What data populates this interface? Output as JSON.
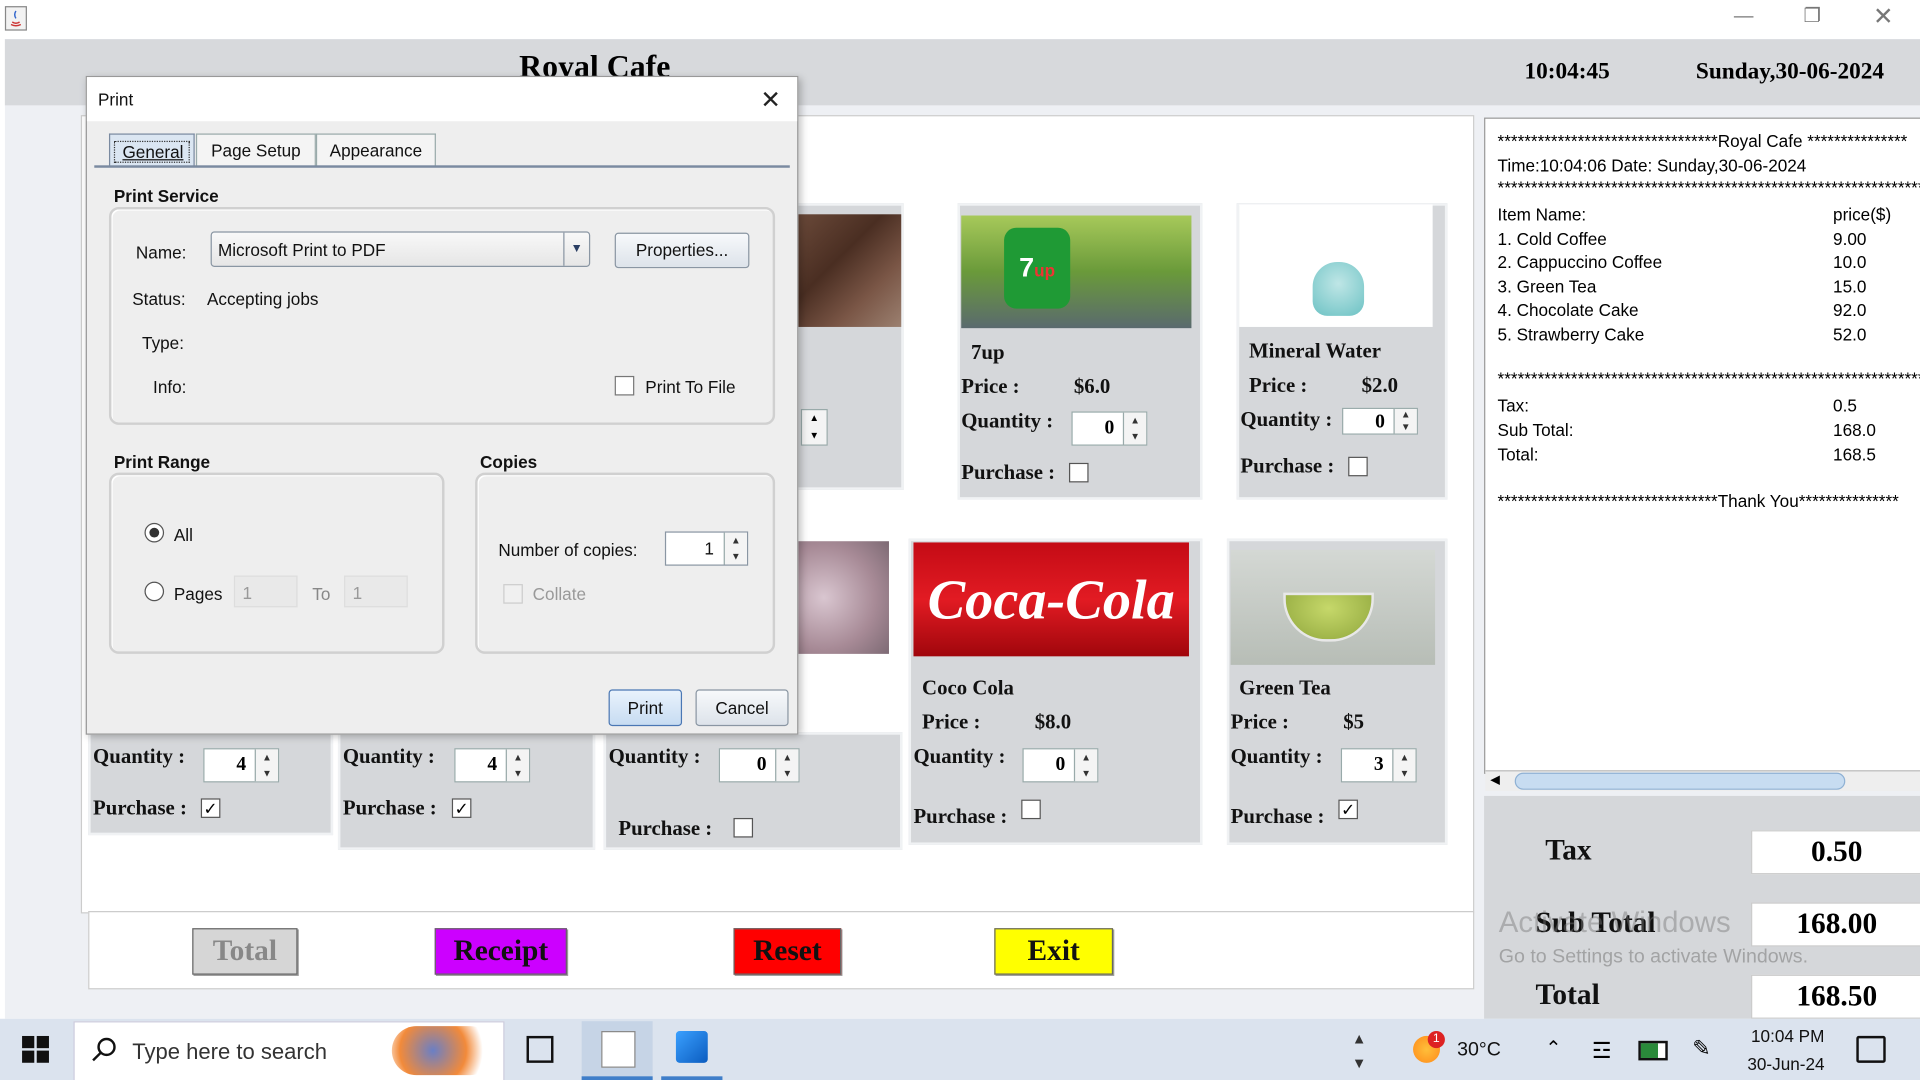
{
  "app": {
    "title": "Royal Cafe",
    "time": "10:04:45",
    "date": "Sunday,30-06-2024"
  },
  "items": [
    {
      "name": "7up",
      "price_label": "Price :",
      "price": "$6.0",
      "qty_label": "Quantity :",
      "qty": "0",
      "purchase_label": "Purchase :",
      "purchased": false
    },
    {
      "name": "Mineral Water",
      "price_label": "Price :",
      "price": "$2.0",
      "qty_label": "Quantity :",
      "qty": "0",
      "purchase_label": "Purchase :",
      "purchased": false
    },
    {
      "name": "Coco Cola",
      "price_label": "Price :",
      "price": "$8.0",
      "qty_label": "Quantity :",
      "qty": "0",
      "purchase_label": "Purchase :",
      "purchased": false
    },
    {
      "name": "Green Tea",
      "price_label": "Price :",
      "price": "$5",
      "qty_label": "Quantity :",
      "qty": "3",
      "purchase_label": "Purchase :",
      "purchased": true
    }
  ],
  "partial_cards": [
    {
      "qty_label": "Quantity :",
      "qty": "4",
      "purchase_label": "Purchase :",
      "purchased": true
    },
    {
      "qty_label": "Quantity :",
      "qty": "4",
      "purchase_label": "Purchase :",
      "purchased": true
    },
    {
      "qty_label": "Quantity :",
      "qty": "0",
      "purchase_label": "Purchase :",
      "purchased": false
    }
  ],
  "buttons": {
    "total": "Total",
    "receipt": "Receipt",
    "reset": "Reset",
    "exit": "Exit",
    "colors": {
      "total": "#d3d3d3",
      "receipt": "#cc00ff",
      "reset": "#ff0000",
      "exit": "#ffff00"
    }
  },
  "receipt": {
    "header": "*********************************Royal Cafe ***************",
    "timeline": "Time:10:04:06 Date: Sunday,30-06-2024",
    "stars": "********************************************************************",
    "col_item": "Item Name:",
    "col_price": "price($)",
    "lines": [
      {
        "item": "1. Cold Coffee",
        "price": "9.00"
      },
      {
        "item": "2. Cappuccino Coffee",
        "price": "10.0"
      },
      {
        "item": "3. Green Tea",
        "price": " 15.0"
      },
      {
        "item": "4. Chocolate Cake",
        "price": "92.0"
      },
      {
        "item": "5. Strawberry Cake",
        "price": "52.0"
      }
    ],
    "tax_label": "Tax:",
    "tax": "0.5",
    "subtotal_label": "Sub Total:",
    "subtotal": "168.0",
    "total_label": "Total:",
    "total": "168.5",
    "footer": "*********************************Thank You***************"
  },
  "totals": {
    "tax_label": "Tax",
    "tax": "0.50",
    "subtotal_label": "Sub Total",
    "subtotal": "168.00",
    "total_label": "Total",
    "total": "168.50"
  },
  "watermark": {
    "line1": "Activate Windows",
    "line2": "Go to Settings to activate Windows."
  },
  "print_dialog": {
    "title": "Print",
    "tabs": [
      "General",
      "Page Setup",
      "Appearance"
    ],
    "print_service_label": "Print Service",
    "name_label": "Name:",
    "name_value": "Microsoft Print to PDF",
    "properties_button": "Properties...",
    "status_label": "Status:",
    "status_value": "Accepting jobs",
    "type_label": "Type:",
    "info_label": "Info:",
    "print_to_file": "Print To File",
    "print_range_label": "Print Range",
    "all_label": "All",
    "pages_label": "Pages",
    "pages_from": "1",
    "to_label": "To",
    "pages_to": "1",
    "copies_label": "Copies",
    "num_copies_label": "Number of copies:",
    "num_copies": "1",
    "collate_label": "Collate",
    "print_button": "Print",
    "cancel_button": "Cancel"
  },
  "taskbar": {
    "search_placeholder": "Type here to search",
    "temperature": "30°C",
    "clock_time": "10:04 PM",
    "clock_date": "30-Jun-24",
    "weather_badge": "1"
  }
}
